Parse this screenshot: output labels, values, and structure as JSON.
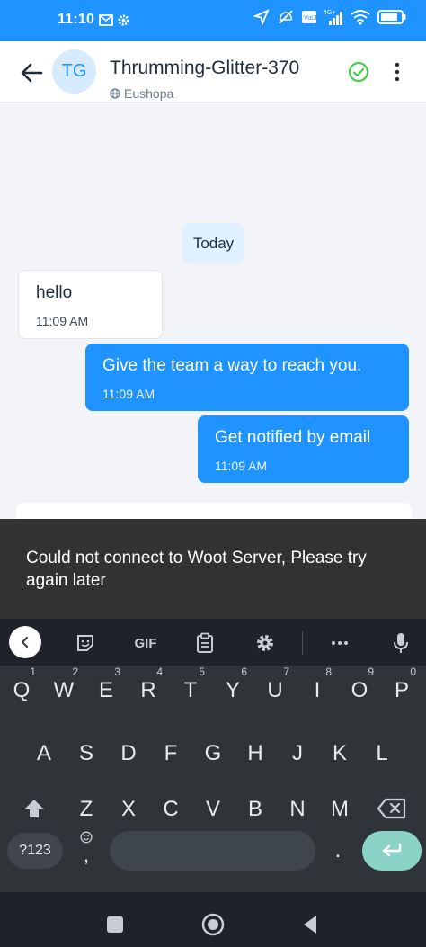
{
  "status_bar": {
    "time": "11:10",
    "colors": {
      "background": "#1f93ff"
    }
  },
  "header": {
    "avatar_initials": "TG",
    "contact_name": "Thrumming-Glitter-370",
    "inbox_name": "Eushopa",
    "icons": [
      "back-arrow-icon",
      "globe-icon",
      "resolve-check-icon",
      "more-vertical-icon"
    ]
  },
  "conversation": {
    "date_separator": "Today",
    "messages": [
      {
        "direction": "incoming",
        "text": "hello",
        "time": "11:09 AM"
      },
      {
        "direction": "outgoing",
        "text": "Give the team a way to reach you.",
        "time": "11:09 AM"
      },
      {
        "direction": "outgoing",
        "text": "Get notified by email",
        "time": "11:09 AM"
      }
    ]
  },
  "snackbar": {
    "message": "Could not connect to Woot Server, Please try again later"
  },
  "keyboard": {
    "toolbar": {
      "gif_label": "GIF",
      "icons": [
        "collapse-icon",
        "sticker-icon",
        "gif-icon",
        "clipboard-icon",
        "settings-icon",
        "more-horizontal-icon",
        "mic-icon"
      ]
    },
    "row1": [
      "Q",
      "W",
      "E",
      "R",
      "T",
      "Y",
      "U",
      "I",
      "O",
      "P"
    ],
    "row1_hints": [
      "1",
      "2",
      "3",
      "4",
      "5",
      "6",
      "7",
      "8",
      "9",
      "0"
    ],
    "row2": [
      "A",
      "S",
      "D",
      "F",
      "G",
      "H",
      "J",
      "K",
      "L"
    ],
    "row3": [
      "Z",
      "X",
      "C",
      "V",
      "B",
      "N",
      "M"
    ],
    "symbols_label": "?123",
    "comma_label": ",",
    "period_label": ".",
    "colors": {
      "background": "#2f3438",
      "enter": "#8cd3c7"
    }
  },
  "nav_bar": {
    "icons": [
      "recents-square-icon",
      "home-circle-icon",
      "back-triangle-icon"
    ]
  }
}
